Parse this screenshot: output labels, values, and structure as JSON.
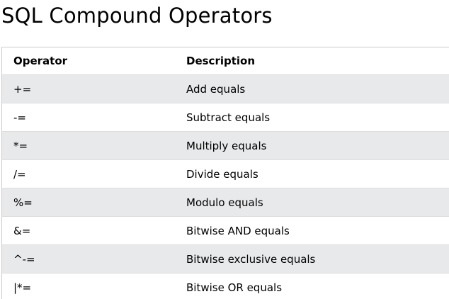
{
  "page": {
    "title": "SQL Compound Operators"
  },
  "table": {
    "headers": {
      "operator": "Operator",
      "description": "Description"
    },
    "rows": [
      {
        "operator": "+=",
        "description": "Add equals"
      },
      {
        "operator": "-=",
        "description": "Subtract equals"
      },
      {
        "operator": "*=",
        "description": "Multiply equals"
      },
      {
        "operator": "/=",
        "description": "Divide equals"
      },
      {
        "operator": "%=",
        "description": "Modulo equals"
      },
      {
        "operator": "&=",
        "description": "Bitwise AND equals"
      },
      {
        "operator": "^-=",
        "description": "Bitwise exclusive equals"
      },
      {
        "operator": "|*=",
        "description": "Bitwise OR equals"
      }
    ]
  },
  "colors": {
    "stripe": "#e7e9eb",
    "border": "#cccccc",
    "text": "#000000"
  }
}
